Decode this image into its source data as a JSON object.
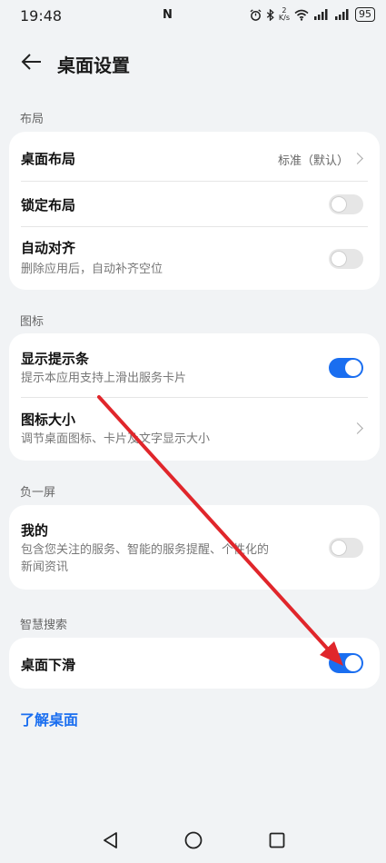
{
  "status_bar": {
    "time": "19:48",
    "nfc": "N",
    "alarm_icon": "alarm-icon",
    "bluetooth_icon": "bluetooth-icon",
    "net_speed_value": "2",
    "net_speed_unit": "K/s",
    "battery": "95"
  },
  "header": {
    "title": "桌面设置",
    "back_icon": "back-arrow-icon"
  },
  "sections": {
    "layout": {
      "label": "布局",
      "desktop_layout": {
        "title": "桌面布局",
        "value": "标准（默认）"
      },
      "lock_layout": {
        "title": "锁定布局",
        "enabled": false
      },
      "auto_align": {
        "title": "自动对齐",
        "subtitle": "删除应用后，自动补齐空位",
        "enabled": false
      }
    },
    "icons": {
      "label": "图标",
      "show_hint_bar": {
        "title": "显示提示条",
        "subtitle": "提示本应用支持上滑出服务卡片",
        "enabled": true
      },
      "icon_size": {
        "title": "图标大小",
        "subtitle": "调节桌面图标、卡片及文字显示大小"
      }
    },
    "minus_one": {
      "label": "负一屏",
      "mine": {
        "title": "我的",
        "subtitle_line1": "包含您关注的服务、智能的服务提醒、个性化的",
        "subtitle_line2": "新闻资讯",
        "enabled": false
      }
    },
    "smart_search": {
      "label": "智慧搜索",
      "swipe_down": {
        "title": "桌面下滑",
        "enabled": true
      }
    }
  },
  "learn_link": "了解桌面",
  "nav": {
    "back": "nav-back-icon",
    "home": "nav-home-icon",
    "recents": "nav-recents-icon"
  },
  "colors": {
    "accent": "#1a6ef0",
    "annotation_arrow": "#e0262b",
    "background": "#f1f3f5"
  }
}
